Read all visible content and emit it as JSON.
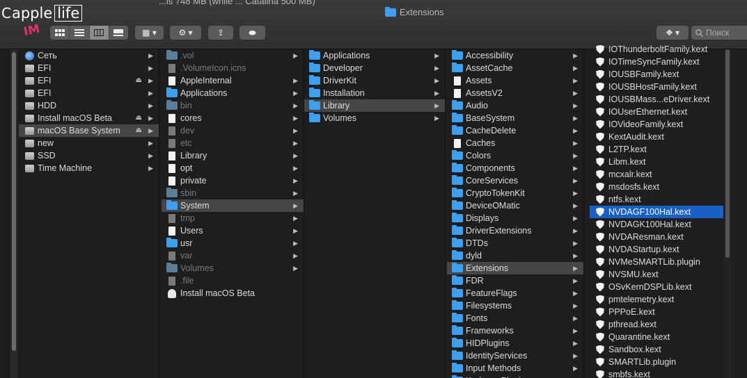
{
  "watermark": {
    "text_a": "apple",
    "text_b": "life",
    "prefix": "C"
  },
  "behind_text": "...is 748 MB (while ... Catalina 500 MB)",
  "window_title": "Extensions",
  "sticker": "IM",
  "toolbar": {
    "view_icons": [
      "icon-view",
      "list-view",
      "column-view",
      "gallery-view"
    ],
    "group_label": "▦ ▾",
    "action_label": "⚙ ▾",
    "share_label": "⇪",
    "tag_label": "⬬",
    "dropbox_label": "❖ ▾",
    "search_placeholder": "Поиск"
  },
  "columns": {
    "sidebar": [
      {
        "label": "Сеть",
        "icon": "network-icon",
        "arrow": "▶"
      },
      {
        "label": "EFI",
        "icon": "disk-icon",
        "arrow": "▶"
      },
      {
        "label": "EFI",
        "icon": "external-disk-icon",
        "arrow": "▶",
        "eject": "⏏"
      },
      {
        "label": "EFI",
        "icon": "external-disk-icon",
        "arrow": "▶"
      },
      {
        "label": "HDD",
        "icon": "disk-icon",
        "arrow": "▶"
      },
      {
        "label": "Install macOS Beta",
        "icon": "external-disk-icon",
        "arrow": "▶",
        "eject": "⏏"
      },
      {
        "label": "macOS Base System",
        "icon": "external-disk-icon",
        "arrow": "▶",
        "eject": "⏏",
        "selected": true
      },
      {
        "label": "new",
        "icon": "disk-icon",
        "arrow": "▶"
      },
      {
        "label": "SSD",
        "icon": "disk-icon",
        "arrow": "▶"
      },
      {
        "label": "Time Machine",
        "icon": "disk-icon",
        "arrow": "▶"
      }
    ],
    "root": [
      {
        "label": ".vol",
        "type": "folder",
        "dim": true,
        "arrow": "▶"
      },
      {
        "label": ".VolumeIcon.icns",
        "type": "doc",
        "dim": true
      },
      {
        "label": "AppleInternal",
        "type": "doc",
        "arrow": "▶"
      },
      {
        "label": "Applications",
        "type": "folder",
        "arrow": "▶"
      },
      {
        "label": "bin",
        "type": "folder",
        "dim": true,
        "arrow": "▶"
      },
      {
        "label": "cores",
        "type": "doc",
        "arrow": "▶"
      },
      {
        "label": "dev",
        "type": "doc",
        "dim": true,
        "arrow": "▶"
      },
      {
        "label": "etc",
        "type": "doc",
        "dim": true,
        "arrow": "▶"
      },
      {
        "label": "Library",
        "type": "doc",
        "arrow": "▶"
      },
      {
        "label": "opt",
        "type": "doc",
        "arrow": "▶"
      },
      {
        "label": "private",
        "type": "doc",
        "arrow": "▶"
      },
      {
        "label": "sbin",
        "type": "folder",
        "dim": true,
        "arrow": "▶"
      },
      {
        "label": "System",
        "type": "folder",
        "arrow": "▶",
        "selected": true
      },
      {
        "label": "tmp",
        "type": "doc",
        "dim": true,
        "arrow": "▶"
      },
      {
        "label": "Users",
        "type": "doc",
        "arrow": "▶"
      },
      {
        "label": "usr",
        "type": "folder",
        "arrow": "▶"
      },
      {
        "label": "var",
        "type": "doc",
        "dim": true,
        "arrow": "▶"
      },
      {
        "label": "Volumes",
        "type": "folder",
        "dim": true,
        "arrow": "▶"
      },
      {
        "label": ".file",
        "type": "doc",
        "dim": true
      },
      {
        "label": "Install macOS Beta",
        "type": "pkg"
      }
    ],
    "system": [
      {
        "label": "Applications",
        "type": "folder",
        "arrow": "▶"
      },
      {
        "label": "Developer",
        "type": "folder",
        "arrow": "▶"
      },
      {
        "label": "DriverKit",
        "type": "folder",
        "arrow": "▶"
      },
      {
        "label": "Installation",
        "type": "folder",
        "arrow": "▶"
      },
      {
        "label": "Library",
        "type": "folder",
        "arrow": "▶",
        "selected": true
      },
      {
        "label": "Volumes",
        "type": "folder",
        "arrow": "▶"
      }
    ],
    "library": [
      {
        "label": "Accessibility",
        "type": "folder",
        "arrow": "▶"
      },
      {
        "label": "AssetCache",
        "type": "folder",
        "arrow": "▶"
      },
      {
        "label": "Assets",
        "type": "doc",
        "arrow": "▶"
      },
      {
        "label": "AssetsV2",
        "type": "doc",
        "arrow": "▶"
      },
      {
        "label": "Audio",
        "type": "folder",
        "arrow": "▶"
      },
      {
        "label": "BaseSystem",
        "type": "folder",
        "arrow": "▶"
      },
      {
        "label": "CacheDelete",
        "type": "folder",
        "arrow": "▶"
      },
      {
        "label": "Caches",
        "type": "doc",
        "arrow": "▶"
      },
      {
        "label": "Colors",
        "type": "folder",
        "arrow": "▶"
      },
      {
        "label": "Components",
        "type": "folder",
        "arrow": "▶"
      },
      {
        "label": "CoreServices",
        "type": "folder",
        "arrow": "▶"
      },
      {
        "label": "CryptoTokenKit",
        "type": "folder",
        "arrow": "▶"
      },
      {
        "label": "DeviceOMatic",
        "type": "folder",
        "arrow": "▶"
      },
      {
        "label": "Displays",
        "type": "folder",
        "arrow": "▶"
      },
      {
        "label": "DriverExtensions",
        "type": "folder",
        "arrow": "▶"
      },
      {
        "label": "DTDs",
        "type": "folder",
        "arrow": "▶"
      },
      {
        "label": "dyld",
        "type": "folder",
        "arrow": "▶"
      },
      {
        "label": "Extensions",
        "type": "folder",
        "arrow": "▶",
        "selected": true
      },
      {
        "label": "FDR",
        "type": "folder",
        "arrow": "▶"
      },
      {
        "label": "FeatureFlags",
        "type": "folder",
        "arrow": "▶"
      },
      {
        "label": "Filesystems",
        "type": "folder",
        "arrow": "▶"
      },
      {
        "label": "Fonts",
        "type": "folder",
        "arrow": "▶"
      },
      {
        "label": "Frameworks",
        "type": "folder",
        "arrow": "▶"
      },
      {
        "label": "HIDPlugins",
        "type": "folder",
        "arrow": "▶"
      },
      {
        "label": "IdentityServices",
        "type": "folder",
        "arrow": "▶"
      },
      {
        "label": "Input Methods",
        "type": "folder",
        "arrow": "▶"
      },
      {
        "label": "KerberosPlugins",
        "type": "folder",
        "arrow": "▶"
      }
    ],
    "extensions": [
      {
        "label": "IOThunderboltFamily.kext"
      },
      {
        "label": "IOTimeSyncFamily.kext"
      },
      {
        "label": "IOUSBFamily.kext"
      },
      {
        "label": "IOUSBHostFamily.kext"
      },
      {
        "label": "IOUSBMass...eDriver.kext"
      },
      {
        "label": "IOUserEthernet.kext"
      },
      {
        "label": "IOVideoFamily.kext"
      },
      {
        "label": "KextAudit.kext"
      },
      {
        "label": "L2TP.kext"
      },
      {
        "label": "Libm.kext"
      },
      {
        "label": "mcxalr.kext"
      },
      {
        "label": "msdosfs.kext"
      },
      {
        "label": "ntfs.kext"
      },
      {
        "label": "NVDAGF100Hal.kext",
        "highlighted": true
      },
      {
        "label": "NVDAGK100Hal.kext"
      },
      {
        "label": "NVDAResman.kext"
      },
      {
        "label": "NVDAStartup.kext"
      },
      {
        "label": "NVMeSMARTLib.plugin"
      },
      {
        "label": "NVSMU.kext"
      },
      {
        "label": "OSvKernDSPLib.kext"
      },
      {
        "label": "pmtelemetry.kext"
      },
      {
        "label": "PPPoE.kext"
      },
      {
        "label": "pthread.kext"
      },
      {
        "label": "Quarantine.kext"
      },
      {
        "label": "Sandbox.kext"
      },
      {
        "label": "SMARTLib.plugin"
      },
      {
        "label": "smbfs.kext"
      }
    ]
  },
  "colors": {
    "highlight": "#1a5fc6",
    "selection": "#464648",
    "folder": "#3d9ff0"
  }
}
